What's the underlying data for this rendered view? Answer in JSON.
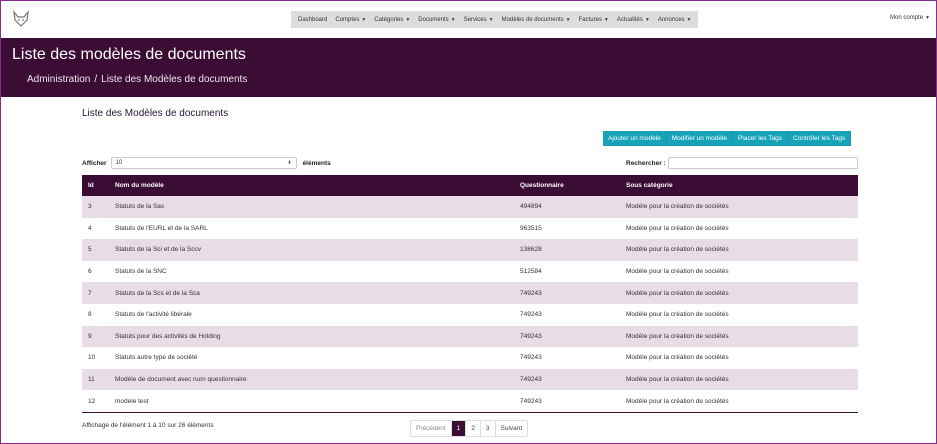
{
  "nav": {
    "logo_icon": "fox-logo-icon",
    "items": [
      {
        "label": "Dashboard",
        "dropdown": false
      },
      {
        "label": "Comptes",
        "dropdown": true
      },
      {
        "label": "Catégories",
        "dropdown": true
      },
      {
        "label": "Documents",
        "dropdown": true
      },
      {
        "label": "Services",
        "dropdown": true
      },
      {
        "label": "Modèles de documents",
        "dropdown": true
      },
      {
        "label": "Factures",
        "dropdown": true
      },
      {
        "label": "Actualités",
        "dropdown": true
      },
      {
        "label": "Annonces",
        "dropdown": true
      }
    ],
    "account_label": "Mon compte"
  },
  "banner": {
    "title": "Liste des modèles de documents",
    "breadcrumb_root": "Administration",
    "breadcrumb_separator": "/",
    "breadcrumb_current": "Liste des Modèles de documents"
  },
  "main": {
    "title": "Liste des Modèles de documents",
    "actions": [
      "Ajouter un modèle",
      "Modifier un modèle",
      "Placer les Tags",
      "Contrôler les Tags"
    ],
    "show_label": "Afficher",
    "page_size": "10",
    "entries_label": "éléments",
    "search_label": "Rechercher :",
    "search_value": ""
  },
  "table": {
    "columns": [
      "Id",
      "Nom du modèle",
      "Questionnaire",
      "Sous catégorie"
    ],
    "rows": [
      {
        "id": "3",
        "nom": "Statuts de la Sas",
        "questionnaire": "494894",
        "sous_categorie": "Modèle pour la création de sociétés"
      },
      {
        "id": "4",
        "nom": "Statuts de l'EURL et de la SARL",
        "questionnaire": "963515",
        "sous_categorie": "Modèle pour la création de sociétés"
      },
      {
        "id": "5",
        "nom": "Statuts de la Sci et de la Sccv",
        "questionnaire": "138628",
        "sous_categorie": "Modèle pour la création de sociétés"
      },
      {
        "id": "6",
        "nom": "Statuts de la SNC",
        "questionnaire": "512584",
        "sous_categorie": "Modèle pour la création de sociétés"
      },
      {
        "id": "7",
        "nom": "Statuts de la Scs et de la Sca",
        "questionnaire": "749243",
        "sous_categorie": "Modèle pour la création de sociétés"
      },
      {
        "id": "8",
        "nom": "Statuts de l'activité libérale",
        "questionnaire": "749243",
        "sous_categorie": "Modèle pour la création de sociétés"
      },
      {
        "id": "9",
        "nom": "Statuts pour des activités de Holding",
        "questionnaire": "749243",
        "sous_categorie": "Modèle pour la création de sociétés"
      },
      {
        "id": "10",
        "nom": "Statuts autre type de société",
        "questionnaire": "749243",
        "sous_categorie": "Modèle pour la création de sociétés"
      },
      {
        "id": "11",
        "nom": "Modèle de document avec num questionnaire",
        "questionnaire": "749243",
        "sous_categorie": "Modèle pour la création de sociétés"
      },
      {
        "id": "12",
        "nom": "modele test",
        "questionnaire": "749243",
        "sous_categorie": "Modèle pour la création de sociétés"
      }
    ]
  },
  "footer": {
    "info": "Affichage de l'élément 1 à 10 sur 26 éléments",
    "pagination": {
      "previous": "Précédent",
      "pages": [
        "1",
        "2",
        "3"
      ],
      "active_page": "1",
      "next": "Suivant"
    }
  },
  "colors": {
    "brand_dark": "#3b0d34",
    "accent_button": "#17a2b8",
    "row_alt": "#e8dce6"
  }
}
